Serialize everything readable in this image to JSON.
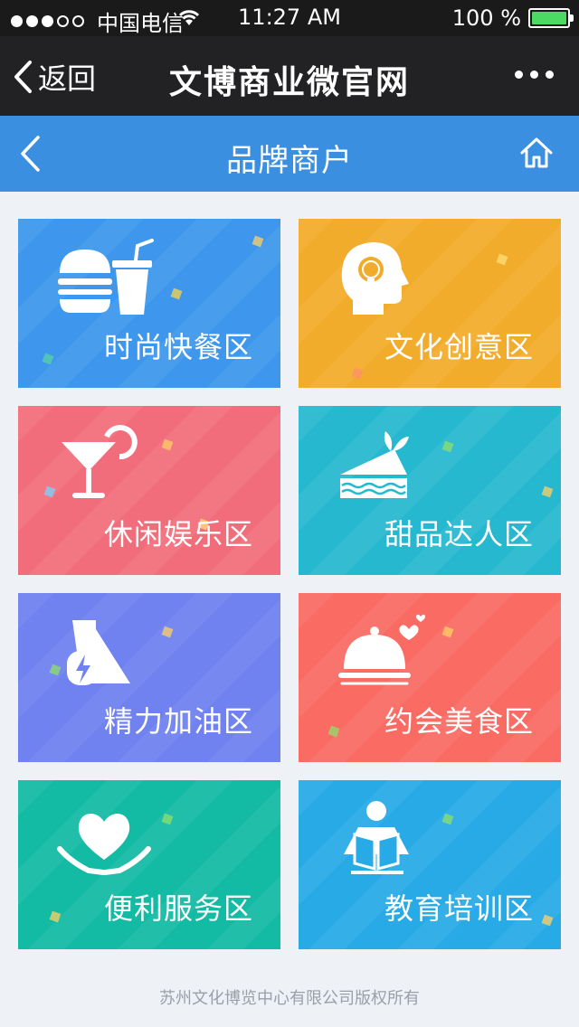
{
  "status_bar": {
    "carrier": "中国电信",
    "time": "11:27 AM",
    "battery": "100 %"
  },
  "wechat_nav": {
    "back_label": "返回",
    "title": "文博商业微官网"
  },
  "page_header": {
    "title": "品牌商户"
  },
  "tiles": [
    {
      "label": "时尚快餐区",
      "color": "#3e97ec",
      "icon": "burger-drink-icon"
    },
    {
      "label": "文化创意区",
      "color": "#f2ac2c",
      "icon": "head-lightbulb-icon"
    },
    {
      "label": "休闲娱乐区",
      "color": "#f26d7b",
      "icon": "cocktail-icon"
    },
    {
      "label": "甜品达人区",
      "color": "#26b8cf",
      "icon": "cake-icon"
    },
    {
      "label": "精力加油区",
      "color": "#6f82ef",
      "icon": "energy-drink-icon"
    },
    {
      "label": "约会美食区",
      "color": "#f96b63",
      "icon": "cloche-heart-icon"
    },
    {
      "label": "便利服务区",
      "color": "#13bba4",
      "icon": "heart-hands-icon"
    },
    {
      "label": "教育培训区",
      "color": "#27aae6",
      "icon": "reading-person-icon"
    }
  ],
  "footer": {
    "copyright": "苏州文化博览中心有限公司版权所有"
  }
}
